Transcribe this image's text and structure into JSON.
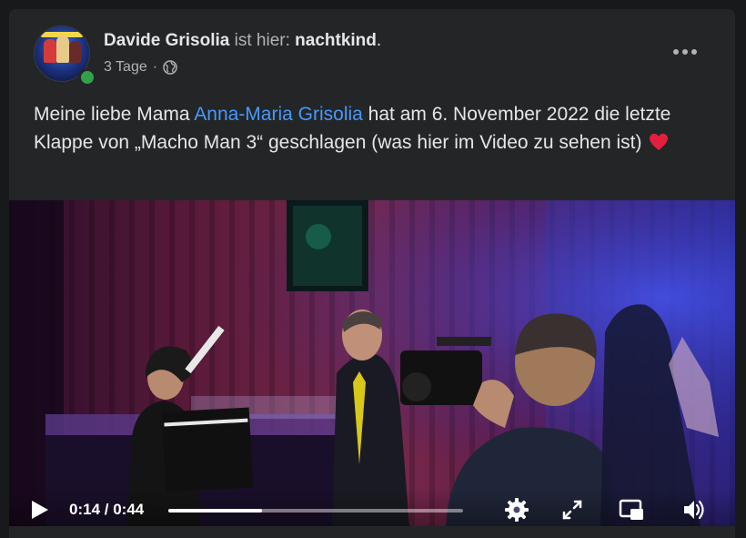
{
  "post": {
    "author": "Davide Grisolia",
    "checkin_text": "ist hier:",
    "place": "nachtkind",
    "place_suffix": ".",
    "timestamp": "3 Tage",
    "separator": "·",
    "audience_icon": "globe-icon",
    "text_part1": "Meine liebe Mama ",
    "mention": "Anna-Maria Grisolia",
    "text_part2": " hat am 6. November 2022 die letzte Klappe von „Macho Man 3“ geschlagen (was hier im Video zu sehen ist) ",
    "emoji": "heart-icon"
  },
  "video": {
    "current_time": "0:14",
    "time_separator": " / ",
    "duration": "0:44",
    "progress_fraction": 0.318,
    "controls": [
      "play-icon",
      "settings-icon",
      "fullscreen-icon",
      "picture-in-picture-icon",
      "volume-icon"
    ]
  },
  "colors": {
    "card_bg": "#242526",
    "text_primary": "#e4e6eb",
    "text_secondary": "#b0b3b8",
    "link": "#4599ff",
    "online": "#31a24c"
  }
}
